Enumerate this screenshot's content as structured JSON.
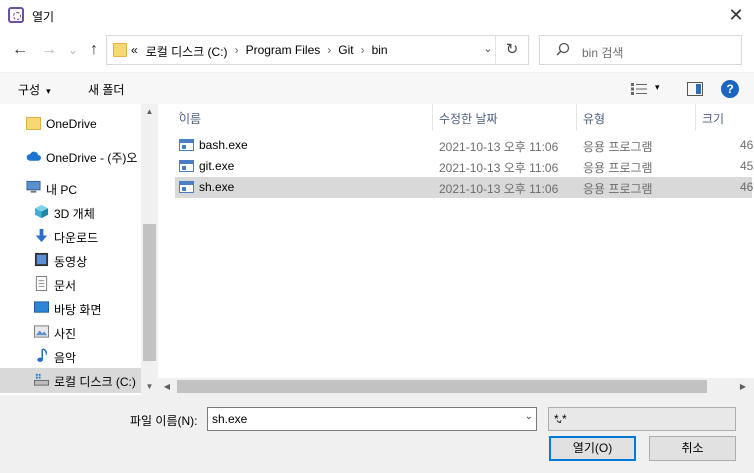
{
  "window": {
    "title": "열기",
    "close_glyph": "✕"
  },
  "nav": {
    "back_glyph": "←",
    "forward_glyph": "→",
    "recent_glyph": "⌄",
    "up_glyph": "↑",
    "breadcrumb": [
      "«",
      "로컬 디스크 (C:)",
      "Program Files",
      "Git",
      "bin"
    ],
    "crumb_sep": "›",
    "address_dropdown_glyph": "⌄",
    "refresh_glyph": "↻",
    "search_placeholder": "bin 검색"
  },
  "toolbar": {
    "organize_label": "구성",
    "new_folder_label": "새 폴더",
    "caret": "▾",
    "help_label": "?"
  },
  "sidebar": {
    "items": [
      {
        "label": "OneDrive",
        "icon": "folder-icon",
        "top": true
      },
      {
        "label": "OneDrive - (주)오",
        "icon": "cloud-icon",
        "top": true
      },
      {
        "label": "내 PC",
        "icon": "pc-icon",
        "top": true
      },
      {
        "label": "3D 개체",
        "icon": "cube-icon"
      },
      {
        "label": "다운로드",
        "icon": "download-icon"
      },
      {
        "label": "동영상",
        "icon": "video-icon"
      },
      {
        "label": "문서",
        "icon": "document-icon"
      },
      {
        "label": "바탕 화면",
        "icon": "desktop-icon"
      },
      {
        "label": "사진",
        "icon": "picture-icon"
      },
      {
        "label": "음악",
        "icon": "music-icon"
      },
      {
        "label": "로컬 디스크 (C:)",
        "icon": "drive-icon",
        "selected": true
      }
    ],
    "scroll_up": "▲",
    "scroll_down": "▼"
  },
  "columns": {
    "name": "이름",
    "date": "수정한 날짜",
    "type": "유형",
    "size": "크기",
    "sort_glyph": "^"
  },
  "files": [
    {
      "name": "bash.exe",
      "date": "2021-10-13 오후 11:06",
      "type": "응용 프로그램",
      "size": "46"
    },
    {
      "name": "git.exe",
      "date": "2021-10-13 오후 11:06",
      "type": "응용 프로그램",
      "size": "45"
    },
    {
      "name": "sh.exe",
      "date": "2021-10-13 오후 11:06",
      "type": "응용 프로그램",
      "size": "46",
      "selected": true
    }
  ],
  "hscroll": {
    "left": "◀",
    "right": "▶"
  },
  "bottom": {
    "filename_label": "파일 이름(N):",
    "filename_value": "sh.exe",
    "filetype_value": "*.*",
    "dropdown_glyph": "⌄",
    "open_label": "열기(O)",
    "cancel_label": "취소"
  }
}
